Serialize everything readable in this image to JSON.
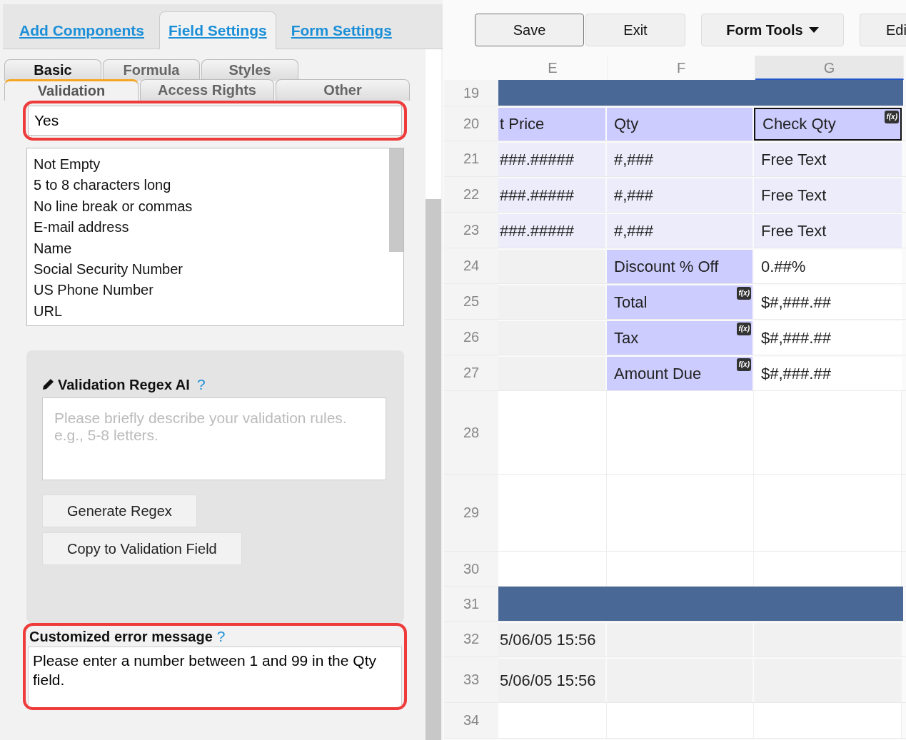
{
  "main_tabs": [
    {
      "label": "Add Components",
      "selected": false
    },
    {
      "label": "Field Settings",
      "selected": true
    },
    {
      "label": "Form Settings",
      "selected": false
    }
  ],
  "sub_tabs": [
    [
      {
        "label": "Basic",
        "selected": false
      },
      {
        "label": "Formula",
        "selected": false
      },
      {
        "label": "Styles",
        "selected": false
      }
    ],
    [
      {
        "label": "Validation",
        "selected": true
      },
      {
        "label": "Access Rights",
        "selected": false
      },
      {
        "label": "Other",
        "selected": false
      }
    ]
  ],
  "validation_field": {
    "value": "Yes",
    "highlighted": true
  },
  "validation_options": [
    "Not Empty",
    "5 to 8 characters long",
    "No line break or commas",
    "E-mail address",
    "Name",
    "Social Security Number",
    "US Phone Number",
    "URL"
  ],
  "regex_ai": {
    "title": "Validation Regex AI",
    "help": "?",
    "placeholder": "Please briefly describe your validation rules. e.g., 5-8 letters.",
    "buttons": [
      "Generate Regex",
      "Copy to Validation Field"
    ]
  },
  "error_message": {
    "label": "Customized error message",
    "help": "?",
    "value": "Please enter a number between 1 and 99 in the Qty field.",
    "highlighted": true
  },
  "toolbar": [
    {
      "label": "Save",
      "kind": "default"
    },
    {
      "label": "Exit",
      "kind": "plain"
    },
    {
      "label": "Form Tools",
      "kind": "menu"
    },
    {
      "label": "Edi",
      "kind": "plain"
    }
  ],
  "columns": [
    {
      "label": "E",
      "selected": false
    },
    {
      "label": "F",
      "selected": false
    },
    {
      "label": "G",
      "selected": true
    }
  ],
  "rows": [
    {
      "number": "19",
      "band": true,
      "cells": []
    },
    {
      "number": "20",
      "band": false,
      "cells": [
        {
          "text": "t Price",
          "kind": "header",
          "selected": false
        },
        {
          "text": "Qty",
          "kind": "header",
          "selected": false
        },
        {
          "text": "Check Qty",
          "kind": "header",
          "badge": "f(x)",
          "selected": true
        }
      ]
    },
    {
      "number": "21",
      "band": false,
      "cells": [
        {
          "text": "###.#####",
          "kind": "light",
          "selected": false
        },
        {
          "text": "#,###",
          "kind": "light",
          "selected": false
        },
        {
          "text": "Free Text",
          "kind": "light",
          "selected": false
        }
      ]
    },
    {
      "number": "22",
      "band": false,
      "cells": [
        {
          "text": "###.#####",
          "kind": "light",
          "selected": false
        },
        {
          "text": "#,###",
          "kind": "light",
          "selected": false
        },
        {
          "text": "Free Text",
          "kind": "light",
          "selected": false
        }
      ]
    },
    {
      "number": "23",
      "band": false,
      "cells": [
        {
          "text": "###.#####",
          "kind": "light",
          "selected": false
        },
        {
          "text": "#,###",
          "kind": "light",
          "selected": false
        },
        {
          "text": "Free Text",
          "kind": "light",
          "selected": false
        }
      ]
    },
    {
      "number": "24",
      "band": false,
      "cells": [
        {
          "kind": "gray",
          "selected": false
        },
        {
          "text": "Discount % Off",
          "kind": "header",
          "selected": false
        },
        {
          "text": "0.##%",
          "kind": "plain",
          "selected": false
        }
      ]
    },
    {
      "number": "25",
      "band": false,
      "cells": [
        {
          "kind": "gray",
          "selected": false
        },
        {
          "text": "Total",
          "kind": "header",
          "badge": "f(x)",
          "selected": false
        },
        {
          "text": "$#,###.##",
          "kind": "plain",
          "selected": false
        }
      ]
    },
    {
      "number": "26",
      "band": false,
      "cells": [
        {
          "kind": "gray",
          "selected": false
        },
        {
          "text": "Tax",
          "kind": "header",
          "badge": "f(x)",
          "selected": false
        },
        {
          "text": "$#,###.##",
          "kind": "plain",
          "selected": false
        }
      ]
    },
    {
      "number": "27",
      "band": false,
      "cells": [
        {
          "kind": "gray",
          "selected": false
        },
        {
          "text": "Amount Due",
          "kind": "header",
          "badge": "f(x)",
          "selected": false
        },
        {
          "text": "$#,###.##",
          "kind": "plain",
          "selected": false
        }
      ]
    },
    {
      "number": "28",
      "band": false,
      "cells": []
    },
    {
      "number": "29",
      "band": false,
      "cells": []
    },
    {
      "number": "30",
      "band": false,
      "cells": []
    },
    {
      "number": "31",
      "band": true,
      "cells": []
    },
    {
      "number": "32",
      "band": false,
      "cells": [
        {
          "text": "5/06/05 15:56",
          "kind": "gray",
          "selected": false
        },
        {
          "kind": "gray",
          "selected": false
        },
        {
          "kind": "gray",
          "selected": false
        }
      ]
    },
    {
      "number": "33",
      "band": false,
      "cells": [
        {
          "text": "5/06/05 15:56",
          "kind": "gray",
          "selected": false
        },
        {
          "kind": "gray",
          "selected": false
        },
        {
          "kind": "gray",
          "selected": false
        }
      ]
    },
    {
      "number": "34",
      "band": false,
      "cells": []
    }
  ]
}
